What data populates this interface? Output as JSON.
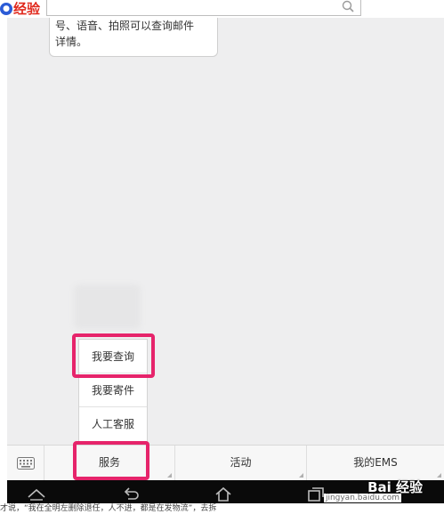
{
  "brand": {
    "logo_text": "经验",
    "paw_glyph": "Bai"
  },
  "search": {
    "value": ""
  },
  "chat": {
    "bubble_lines": [
      "号、语音、拍照可以查询邮件",
      "详情。"
    ]
  },
  "popup_menu": {
    "items": [
      {
        "label": "我要查询",
        "highlighted": true
      },
      {
        "label": "我要寄件",
        "highlighted": false
      },
      {
        "label": "人工客服",
        "highlighted": false
      }
    ]
  },
  "menubar": {
    "tabs": [
      {
        "label": "服务",
        "highlighted": true
      },
      {
        "label": "活动",
        "highlighted": false
      },
      {
        "label": "我的EMS",
        "highlighted": false
      }
    ]
  },
  "watermark": {
    "brand": "Bai 经验",
    "url": "jingyan.baidu.com"
  },
  "caption": {
    "text": "才说，“我在全明左删除退任，人不进，都是在发物流”，去拆"
  },
  "colors": {
    "highlight": "#e6246b",
    "brand_red": "#e0281c",
    "brand_blue": "#2b5bd6"
  }
}
